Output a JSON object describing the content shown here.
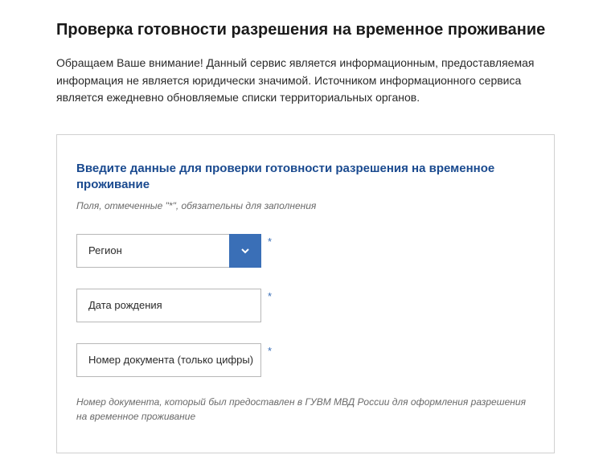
{
  "page": {
    "title": "Проверка готовности разрешения на временное проживание",
    "intro": "Обращаем Ваше внимание! Данный сервис является информационным, предоставляемая информация не является юридически значимой. Источником информационного сервиса является ежедневно обновляемые списки территориальных органов."
  },
  "form": {
    "heading": "Введите данные для проверки готовности разрешения на временное проживание",
    "required_note": "Поля, отмеченные \"*\", обязательны для заполнения",
    "asterisk": "*",
    "fields": {
      "region": {
        "label": "Регион"
      },
      "birthdate": {
        "label": "Дата рождения"
      },
      "docnum": {
        "label": "Номер документа (только цифры)",
        "hint": "Номер документа, который был предоставлен в ГУВМ МВД России для оформления разрешения на временное проживание"
      }
    }
  }
}
